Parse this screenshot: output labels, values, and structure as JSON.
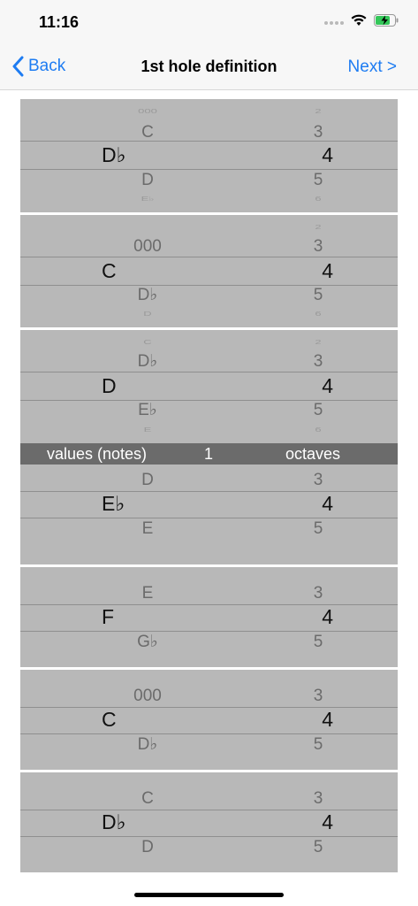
{
  "status": {
    "time": "11:16",
    "icons": [
      "signal-dots-icon",
      "wifi-icon",
      "battery-charging-icon"
    ]
  },
  "nav": {
    "back_label": "Back",
    "title": "1st hole definition",
    "next_label": "Next >"
  },
  "colors": {
    "accent": "#1e7cf2",
    "picker_bg": "#b8b8b8",
    "label_bar_bg": "#6b6b6b"
  },
  "label_bar": {
    "left": "values (notes)",
    "middle": "1",
    "right": "octaves"
  },
  "pickers": [
    {
      "note": {
        "far_above": "000",
        "above": "C",
        "selected": "D♭",
        "below": "D",
        "far_below": "E♭"
      },
      "octave": {
        "far_above": "2",
        "above": "3",
        "selected": "4",
        "below": "5",
        "far_below": "6"
      }
    },
    {
      "note": {
        "far_above": "",
        "above": "000",
        "selected": "C",
        "below": "D♭",
        "far_below": "D"
      },
      "octave": {
        "far_above": "2",
        "above": "3",
        "selected": "4",
        "below": "5",
        "far_below": "6"
      }
    },
    {
      "note": {
        "far_above": "C",
        "above": "D♭",
        "selected": "D",
        "below": "E♭",
        "far_below": "E"
      },
      "octave": {
        "far_above": "2",
        "above": "3",
        "selected": "4",
        "below": "5",
        "far_below": "6"
      }
    },
    {
      "note": {
        "far_above": "",
        "above": "D",
        "selected": "E♭",
        "below": "E",
        "far_below": ""
      },
      "octave": {
        "far_above": "",
        "above": "3",
        "selected": "4",
        "below": "5",
        "far_below": ""
      }
    },
    {
      "note": {
        "far_above": "",
        "above": "E",
        "selected": "F",
        "below": "G♭",
        "far_below": ""
      },
      "octave": {
        "far_above": "",
        "above": "3",
        "selected": "4",
        "below": "5",
        "far_below": ""
      }
    },
    {
      "note": {
        "far_above": "",
        "above": "000",
        "selected": "C",
        "below": "D♭",
        "far_below": ""
      },
      "octave": {
        "far_above": "",
        "above": "3",
        "selected": "4",
        "below": "5",
        "far_below": ""
      }
    },
    {
      "note": {
        "far_above": "",
        "above": "C",
        "selected": "D♭",
        "below": "D",
        "far_below": ""
      },
      "octave": {
        "far_above": "",
        "above": "3",
        "selected": "4",
        "below": "5",
        "far_below": ""
      }
    }
  ]
}
